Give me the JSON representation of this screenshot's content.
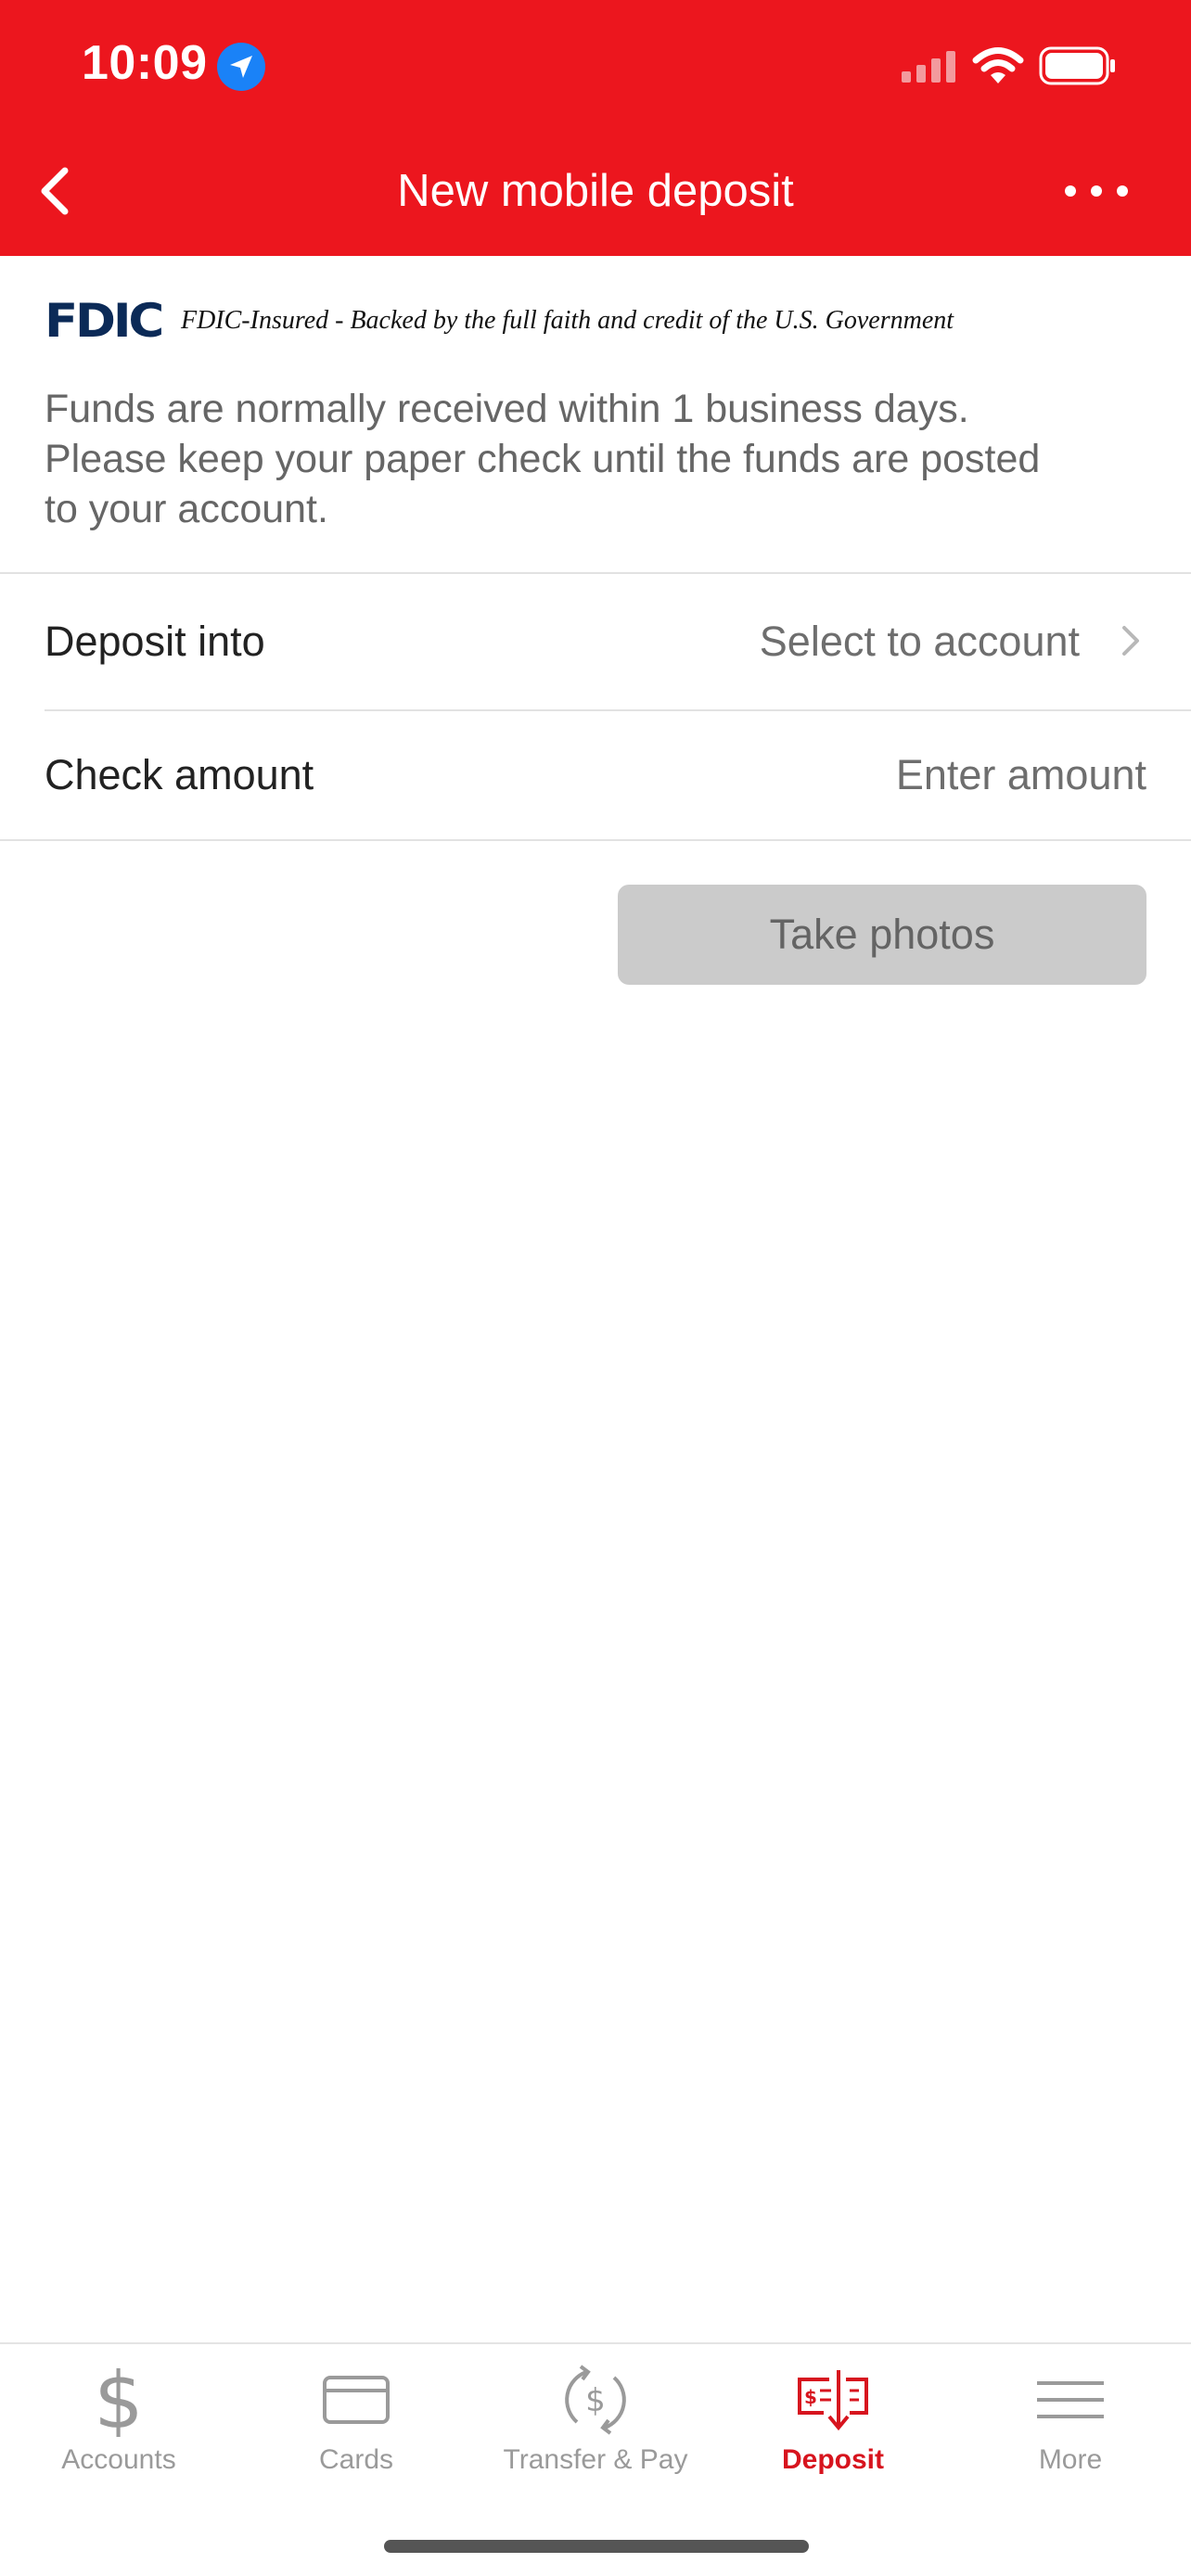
{
  "status_bar": {
    "time": "10:09"
  },
  "nav": {
    "title": "New mobile deposit"
  },
  "fdic": {
    "logo": "FDIC",
    "text": "FDIC-Insured - Backed by the full faith and credit of the U.S. Government"
  },
  "info": {
    "line1": "Funds are normally received within 1 business days.",
    "line2": "Please keep your paper check until the funds are posted",
    "line3": "to your account."
  },
  "form": {
    "deposit_into": {
      "label": "Deposit into",
      "value": "Select to account"
    },
    "check_amount": {
      "label": "Check amount",
      "placeholder": "Enter amount"
    }
  },
  "actions": {
    "take_photos": "Take photos"
  },
  "tabs": [
    {
      "label": "Accounts",
      "icon": "dollar-icon",
      "active": false
    },
    {
      "label": "Cards",
      "icon": "card-icon",
      "active": false
    },
    {
      "label": "Transfer & Pay",
      "icon": "transfer-pay-icon",
      "active": false
    },
    {
      "label": "Deposit",
      "icon": "check-deposit-icon",
      "active": true
    },
    {
      "label": "More",
      "icon": "menu-icon",
      "active": false
    }
  ],
  "colors": {
    "brand_red": "#EC161E",
    "active_tab": "#D7141E",
    "disabled_button": "#CBCBCB",
    "location_blue": "#1A82F7",
    "fdic_navy": "#0B2A57"
  }
}
